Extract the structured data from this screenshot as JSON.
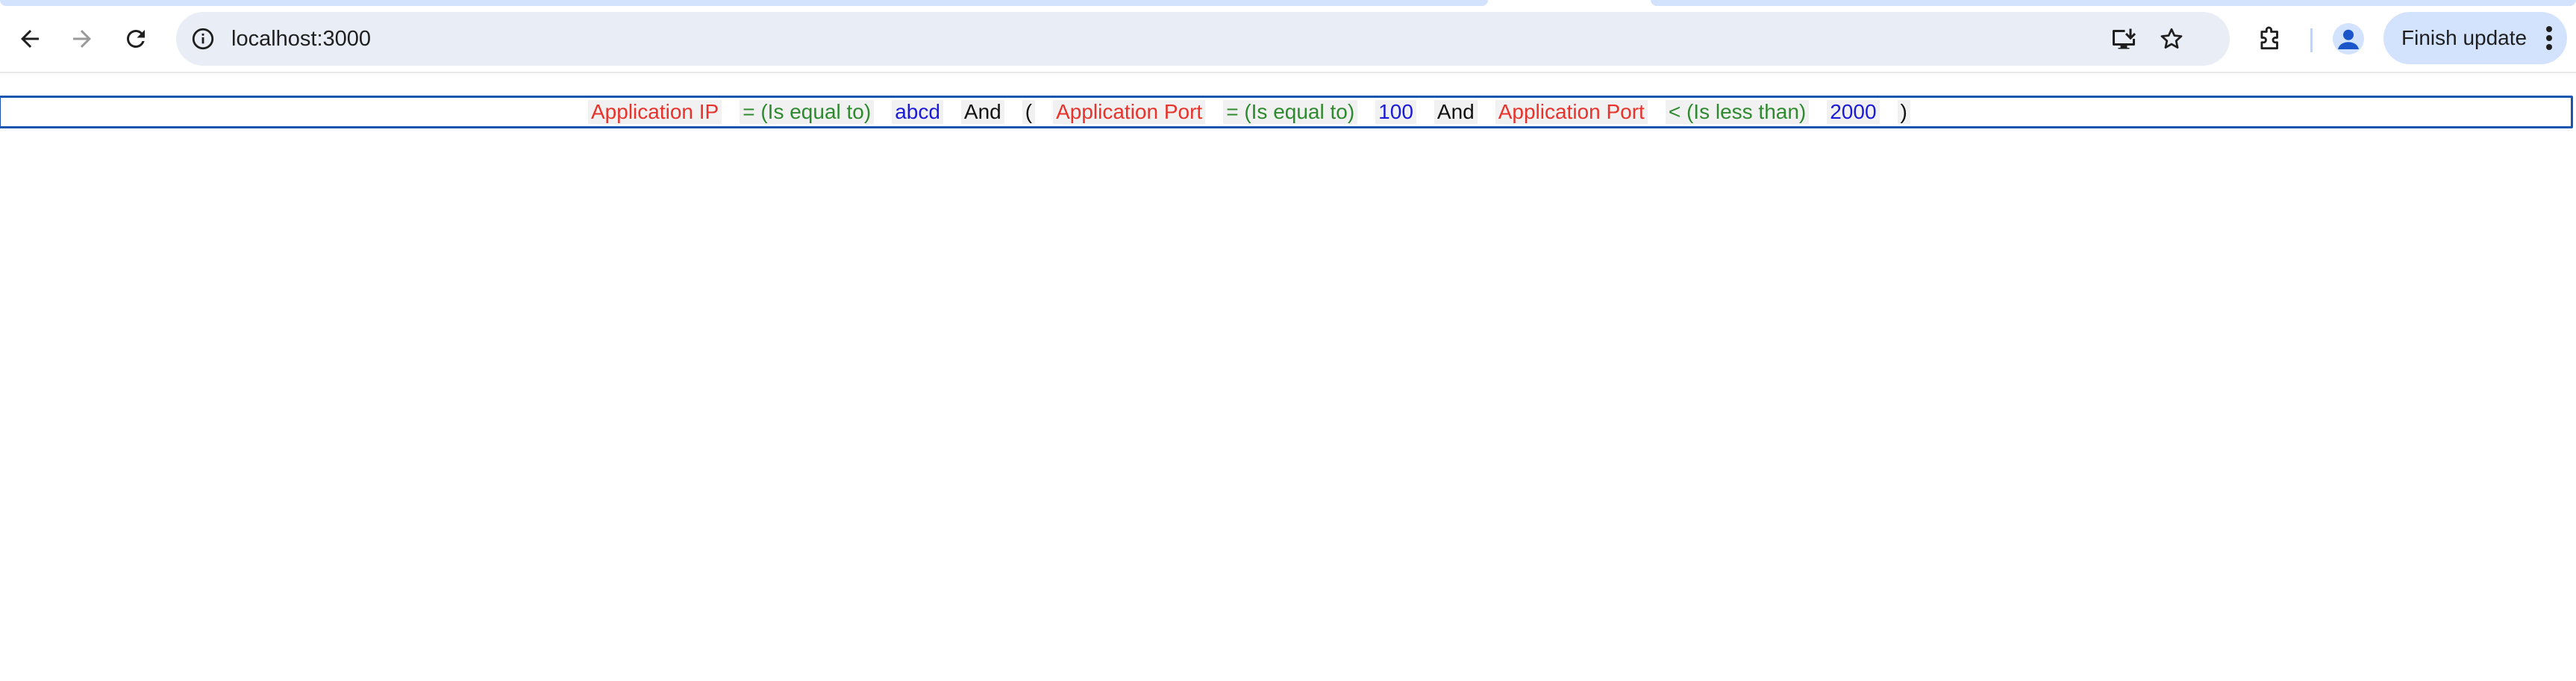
{
  "browser": {
    "address_bar": {
      "url": "localhost:3000"
    },
    "finish_update_label": "Finish update",
    "colors": {
      "omnibox_bg": "#e9eef6",
      "update_button_bg": "#d3e3fd"
    }
  },
  "query": {
    "tokens": [
      {
        "kind": "field",
        "text": "Application IP"
      },
      {
        "kind": "op",
        "text": "= (Is equal to)"
      },
      {
        "kind": "value",
        "text": "abcd"
      },
      {
        "kind": "logic",
        "text": "And"
      },
      {
        "kind": "paren",
        "text": "("
      },
      {
        "kind": "field",
        "text": "Application Port"
      },
      {
        "kind": "op",
        "text": "= (Is equal to)"
      },
      {
        "kind": "value",
        "text": "100"
      },
      {
        "kind": "logic",
        "text": "And"
      },
      {
        "kind": "field",
        "text": "Application Port"
      },
      {
        "kind": "op",
        "text": "< (Is less than)"
      },
      {
        "kind": "value",
        "text": "2000"
      },
      {
        "kind": "paren",
        "text": ")"
      }
    ],
    "colors": {
      "field": "#e8322c",
      "operator": "#2e8a2e",
      "value": "#1a1ad8",
      "border": "#1a55b0"
    }
  }
}
